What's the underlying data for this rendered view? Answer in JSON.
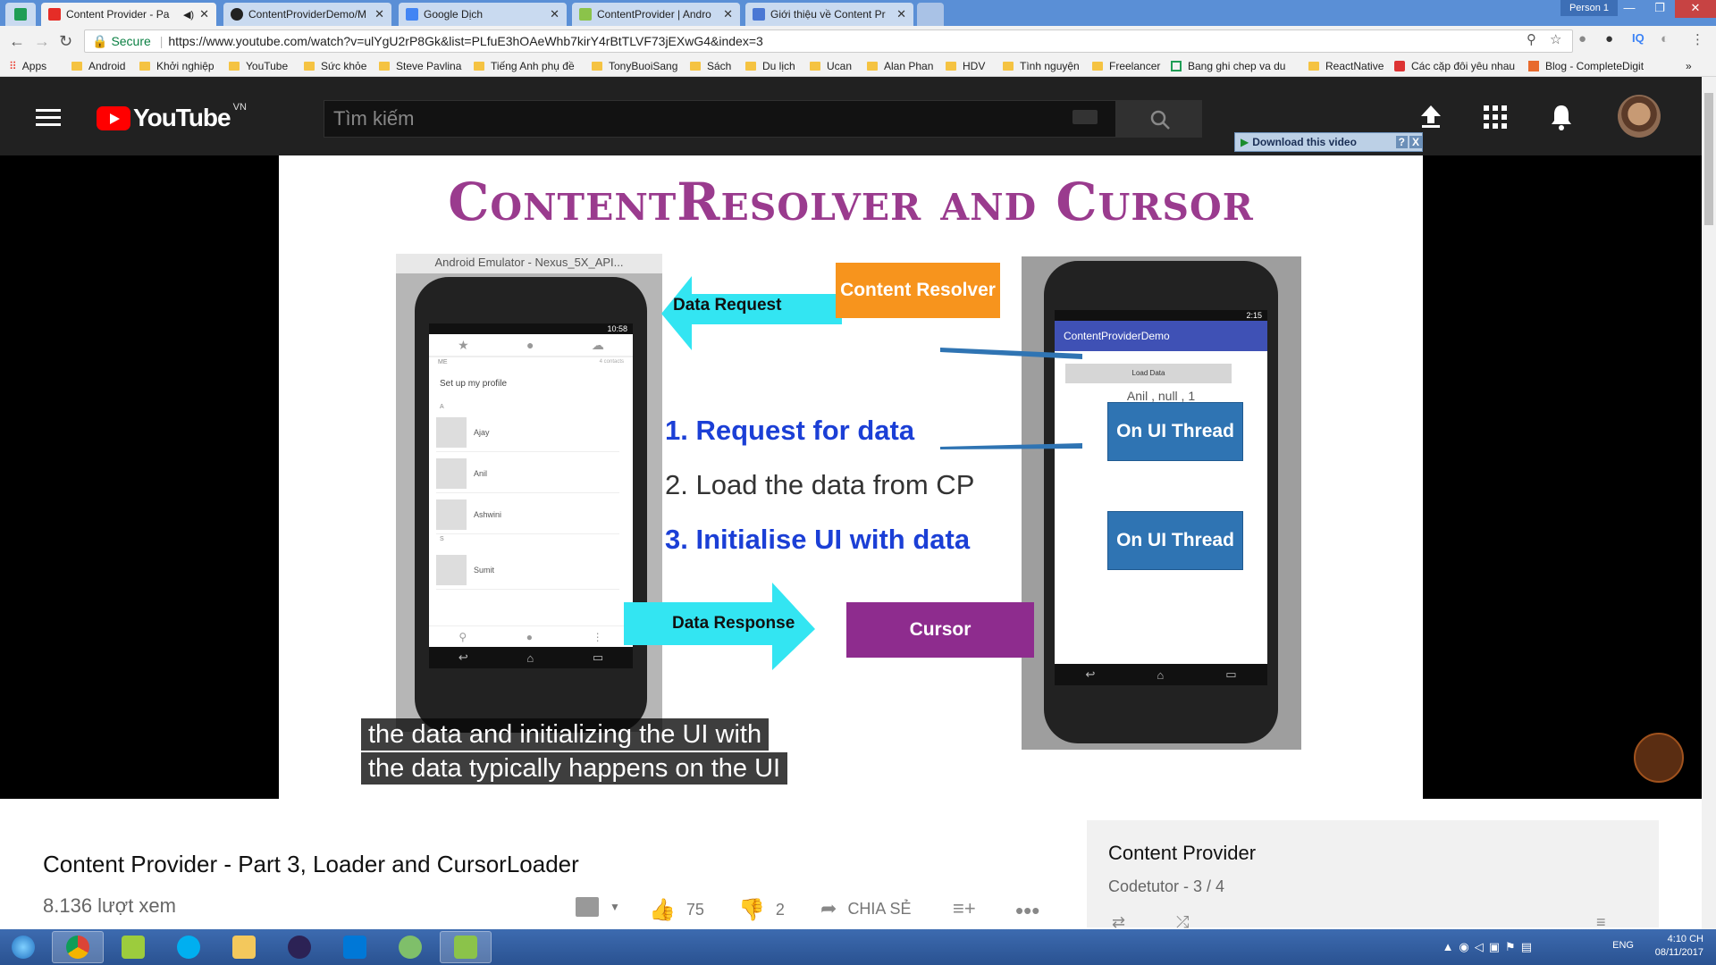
{
  "browser": {
    "tabs": [
      {
        "title": "Content Provider - Pa",
        "active": true,
        "icon_color": "#e52d27"
      },
      {
        "title": "ContentProviderDemo/M",
        "active": false,
        "icon_color": "#222222"
      },
      {
        "title": "Google Dịch",
        "active": false,
        "icon_color": "#4285f4"
      },
      {
        "title": "ContentProvider | Andro",
        "active": false,
        "icon_color": "#8bc34a"
      },
      {
        "title": "Giới thiệu về Content Pr",
        "active": false,
        "icon_color": "#4a77d4"
      }
    ],
    "person_label": "Person 1",
    "secure_label": "Secure",
    "url": "https://www.youtube.com/watch?v=ulYgU2rP8Gk&list=PLfuE3hOAeWhb7kirY4rBtTLVF73jEXwG4&index=3",
    "bookmarks": [
      "Apps",
      "Android",
      "Khởi nghiệp",
      "YouTube",
      "Sức khỏe",
      "Steve Pavlina",
      "Tiếng Anh phụ đề",
      "TonyBuoiSang",
      "Sách",
      "Du lịch",
      "Ucan",
      "Alan Phan",
      "HDV",
      "Tình nguyện",
      "Freelancer",
      "Bang ghi chep va du",
      "ReactNative",
      "Các cặp đôi yêu nhau",
      "Blog - CompleteDigit"
    ],
    "bookmarks_overflow": "»"
  },
  "youtube": {
    "logo_text": "YouTube",
    "region": "VN",
    "search_placeholder": "Tìm kiếm",
    "download_banner": "Download this video"
  },
  "slide": {
    "title": "ContentResolver and Cursor",
    "emulator_title": "Android Emulator - Nexus_5X_API...",
    "left_phone": {
      "time": "10:58",
      "section_me": "ME",
      "contacts_count": "4 contacts",
      "setup_profile": "Set up my profile",
      "section_a": "A",
      "section_s": "S",
      "contacts": [
        "Ajay",
        "Anil",
        "Ashwini",
        "Sumit"
      ]
    },
    "right_phone": {
      "time": "2:15",
      "app_title": "ContentProviderDemo",
      "load_button": "Load Data",
      "result": "Anil , null , 1"
    },
    "data_request": "Data Request",
    "content_resolver": "Content Resolver",
    "step1": "1. Request for data",
    "step2": "2. Load the data from CP",
    "step3": "3. Initialise UI with data",
    "ui_thread_1": "On UI Thread",
    "ui_thread_2": "On UI Thread",
    "data_response": "Data Response",
    "cursor": "Cursor",
    "colors": {
      "title": "#9a3b8e",
      "resolver": "#f7941d",
      "cursor": "#8e2c8e",
      "arrow": "#33e5f2",
      "thread": "#2f74b3"
    }
  },
  "captions": [
    "the data and initializing the UI with",
    "the data typically happens on the UI"
  ],
  "video": {
    "title": "Content Provider - Part 3, Loader and CursorLoader",
    "views": "8.136 lượt xem",
    "likes": "75",
    "dislikes": "2",
    "share": "CHIA SẺ"
  },
  "playlist": {
    "title": "Content Provider",
    "subtitle": "Codetutor - 3 / 4"
  },
  "taskbar": {
    "lang": "ENG",
    "time": "4:10 CH",
    "date": "08/11/2017",
    "apps": [
      "start",
      "chrome",
      "notepad",
      "skype",
      "explorer",
      "eclipse",
      "vscode",
      "paint",
      "android-studio"
    ]
  }
}
